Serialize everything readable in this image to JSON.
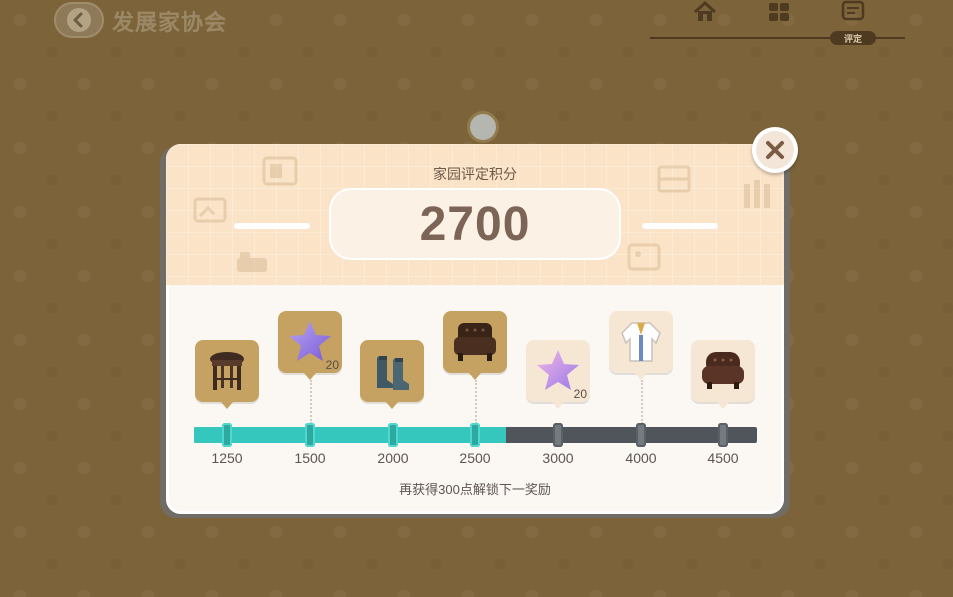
{
  "header": {
    "title": "发展家协会",
    "nav": [
      {
        "icon": "home-icon"
      },
      {
        "icon": "grid-icon"
      },
      {
        "icon": "rating-icon",
        "label": "评定"
      }
    ]
  },
  "modal": {
    "title": "家园评定积分",
    "score": "2700",
    "progress_fraction": 0.555,
    "milestones": [
      {
        "value": "1250",
        "reward": "stool",
        "qty": "",
        "unlocked": true
      },
      {
        "value": "1500",
        "reward": "purple-star",
        "qty": "20",
        "unlocked": true
      },
      {
        "value": "2000",
        "reward": "boots",
        "qty": "",
        "unlocked": true
      },
      {
        "value": "2500",
        "reward": "leather-armchair",
        "qty": "",
        "unlocked": true
      },
      {
        "value": "3000",
        "reward": "purple-star",
        "qty": "20",
        "unlocked": false
      },
      {
        "value": "4000",
        "reward": "jacket",
        "qty": "",
        "unlocked": false
      },
      {
        "value": "4500",
        "reward": "leather-armchair",
        "qty": "",
        "unlocked": false
      }
    ],
    "footer": "再获得300点解锁下一奖励"
  },
  "colors": {
    "progress_fill": "#35c7be",
    "progress_track": "#4f555a",
    "card_unlocked": "#c5a261",
    "card_locked": "#f6e7d5"
  }
}
